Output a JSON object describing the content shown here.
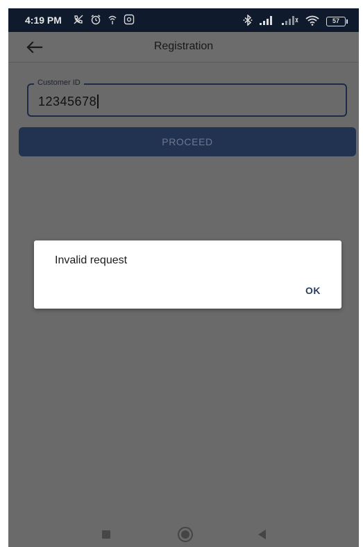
{
  "status_bar": {
    "time": "4:19 PM",
    "battery_level": "57",
    "icons": [
      "no-call-icon",
      "alarm-icon",
      "wifi-calling-icon",
      "app-notification-icon",
      "bluetooth-icon",
      "signal-icon",
      "signal-weak-icon",
      "wifi-icon",
      "battery-icon"
    ]
  },
  "app_bar": {
    "title": "Registration",
    "back_icon": "arrow-left-icon"
  },
  "form": {
    "customer_id_label": "Customer ID",
    "customer_id_value": "12345678",
    "proceed_label": "PROCEED"
  },
  "dialog": {
    "message": "Invalid request",
    "ok_label": "OK"
  },
  "nav_bar": {
    "icons": [
      "recents-icon",
      "home-icon",
      "back-icon"
    ]
  },
  "colors": {
    "status_bar": "#0f1a2c",
    "scrim": "#6a6a6a",
    "primary": "#223251",
    "field_border": "#1c2b48",
    "dialog_bg": "#ffffff"
  }
}
